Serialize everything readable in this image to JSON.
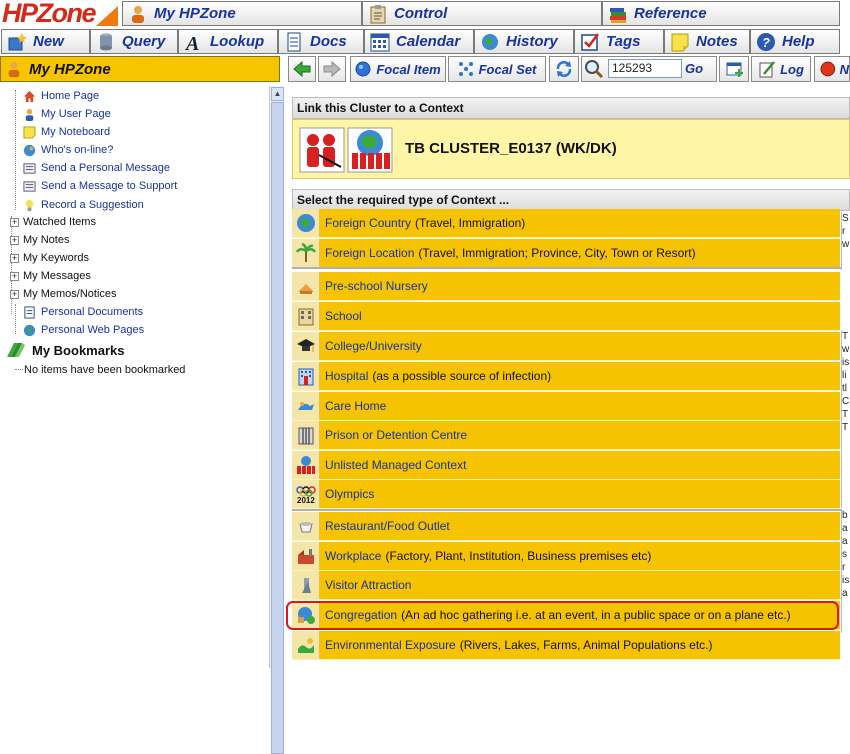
{
  "logo": {
    "text": "HPZone"
  },
  "top_menu": [
    {
      "label": "My HPZone",
      "icon": "user-icon"
    },
    {
      "label": "Control",
      "icon": "clipboard-icon"
    },
    {
      "label": "Reference",
      "icon": "books-icon"
    }
  ],
  "second_menu": [
    {
      "label": "New",
      "icon": "new-icon"
    },
    {
      "label": "Query",
      "icon": "database-icon"
    },
    {
      "label": "Lookup",
      "icon": "font-a-icon"
    },
    {
      "label": "Docs",
      "icon": "document-icon"
    },
    {
      "label": "Calendar",
      "icon": "calendar-icon"
    },
    {
      "label": "History",
      "icon": "globe-icon"
    },
    {
      "label": "Tags",
      "icon": "checkbox-icon"
    },
    {
      "label": "Notes",
      "icon": "sticky-note-icon"
    },
    {
      "label": "Help",
      "icon": "help-icon"
    }
  ],
  "sidebar_title": "My HPZone",
  "toolbar": {
    "focal_item": "Focal Item",
    "focal_set": "Focal Set",
    "search_value": "125293",
    "go": "Go",
    "log": "Log",
    "cut_label": "N"
  },
  "tree": {
    "items": [
      {
        "label": "Home Page",
        "type": "link",
        "icon": "home-icon"
      },
      {
        "label": "My User Page",
        "type": "link",
        "icon": "user-icon"
      },
      {
        "label": "My Noteboard",
        "type": "link",
        "icon": "sticky-note-icon"
      },
      {
        "label": "Who's on-line?",
        "type": "link",
        "icon": "globe-user-icon"
      },
      {
        "label": "Send a Personal Message",
        "type": "link",
        "icon": "message-icon"
      },
      {
        "label": "Send a Message to Support",
        "type": "link",
        "icon": "message-icon"
      },
      {
        "label": "Record a Suggestion",
        "type": "link",
        "icon": "lightbulb-icon"
      },
      {
        "label": "Watched Items",
        "type": "folder"
      },
      {
        "label": "My Notes",
        "type": "folder"
      },
      {
        "label": "My Keywords",
        "type": "folder"
      },
      {
        "label": "My Messages",
        "type": "folder"
      },
      {
        "label": "My Memos/Notices",
        "type": "folder"
      },
      {
        "label": "Personal Documents",
        "type": "link",
        "icon": "document-icon"
      },
      {
        "label": "Personal Web Pages",
        "type": "link",
        "icon": "globe-icon"
      }
    ],
    "bookmarks_title": "My Bookmarks",
    "bookmarks_empty": "No items have been bookmarked"
  },
  "main": {
    "link_header": "Link this Cluster to a Context",
    "cluster_title": "TB CLUSTER_E0137 (WK/DK)",
    "select_header": "Select the required type of Context ...",
    "contexts": [
      {
        "name": "Foreign Country",
        "desc": "(Travel, Immigration)",
        "icon": "globe-icon"
      },
      {
        "name": "Foreign Location",
        "desc": "(Travel, Immigration; Province, City, Town or Resort)",
        "icon": "palm-tree-icon"
      },
      {
        "name": "Pre-school Nursery",
        "desc": "",
        "icon": "toy-icon"
      },
      {
        "name": "School",
        "desc": "",
        "icon": "school-icon"
      },
      {
        "name": "College/University",
        "desc": "",
        "icon": "graduation-cap-icon"
      },
      {
        "name": "Hospital",
        "desc": "(as a possible source of infection)",
        "icon": "hospital-icon"
      },
      {
        "name": "Care Home",
        "desc": "",
        "icon": "care-home-icon"
      },
      {
        "name": "Prison or Detention Centre",
        "desc": "",
        "icon": "prison-icon"
      },
      {
        "name": "Unlisted Managed Context",
        "desc": "",
        "icon": "people-icon"
      },
      {
        "name": "Olympics",
        "desc": "",
        "icon": "olympics-icon"
      },
      {
        "name": "Restaurant/Food Outlet",
        "desc": "",
        "icon": "cup-icon"
      },
      {
        "name": "Workplace",
        "desc": "(Factory, Plant, Institution, Business premises etc)",
        "icon": "factory-icon"
      },
      {
        "name": "Visitor Attraction",
        "desc": "",
        "icon": "attraction-icon"
      },
      {
        "name": "Congregation",
        "desc": "(An ad hoc gathering i.e. at an event, in a public space or on a plane etc.)",
        "icon": "congregation-icon"
      },
      {
        "name": "Environmental Exposure",
        "desc": "(Rivers, Lakes, Farms, Animal Populations etc.)",
        "icon": "environment-icon"
      }
    ],
    "olympics_year": "2012",
    "side_text": [
      "S",
      "r",
      "w",
      "T",
      "w",
      "is",
      "li",
      "tl",
      "C",
      "T",
      "T",
      "b",
      "a",
      "a",
      "s",
      "r",
      "is",
      "a"
    ]
  },
  "colors": {
    "row": "#f6c300",
    "link": "#1733a0",
    "highlight": "#e01616"
  }
}
